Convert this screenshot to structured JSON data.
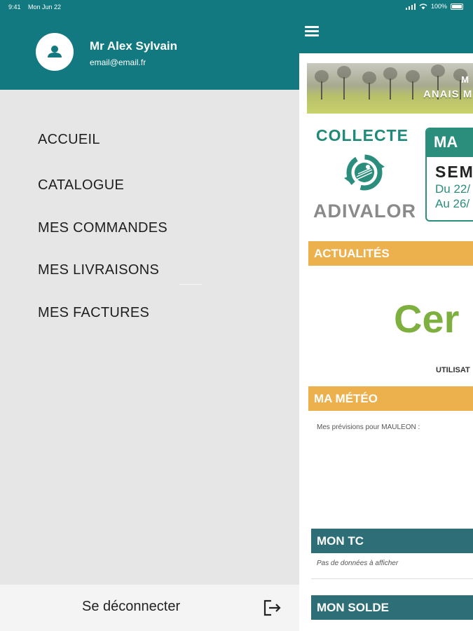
{
  "status_bar": {
    "time": "9:41",
    "date": "Mon Jun 22",
    "battery": "100%"
  },
  "drawer": {
    "user_name": "Mr Alex Sylvain",
    "user_email": "email@email.fr",
    "avatar_icon": "person-icon",
    "nav_items": [
      {
        "label": "ACCUEIL"
      },
      {
        "label": "CATALOGUE"
      },
      {
        "label": "MES COMMANDES"
      },
      {
        "label": "MES LIVRAISONS"
      },
      {
        "label": "MES FACTURES"
      }
    ],
    "logout_label": "Se déconnecter",
    "logout_icon": "logout-icon"
  },
  "main": {
    "menu_icon": "hamburger-menu-icon",
    "banner": {
      "subtitle": "M",
      "title": "ANAIS M"
    },
    "collecte": {
      "title": "COLLECTE",
      "brand": "ADIVALOR",
      "box_head": "MA",
      "box_week": "SEM",
      "date_from": "Du 22/",
      "date_to": "Au 26/"
    },
    "sections": {
      "news": "ACTUALITÉS",
      "weather": "MA MÉTÉO",
      "tc": "MON TC",
      "balance": "MON SOLDE"
    },
    "news_big_text": "Cer",
    "news_sub_text": "UTILISAT",
    "weather_text": "Mes prévisions pour MAULEON :",
    "tc_empty": "Pas de données à afficher"
  },
  "colors": {
    "primary": "#11797f",
    "drawer_bg": "#e6e6e6",
    "section_yellow": "#ecb04d",
    "section_teal": "#2d6e77",
    "collecte_green": "#2b8e7c"
  }
}
